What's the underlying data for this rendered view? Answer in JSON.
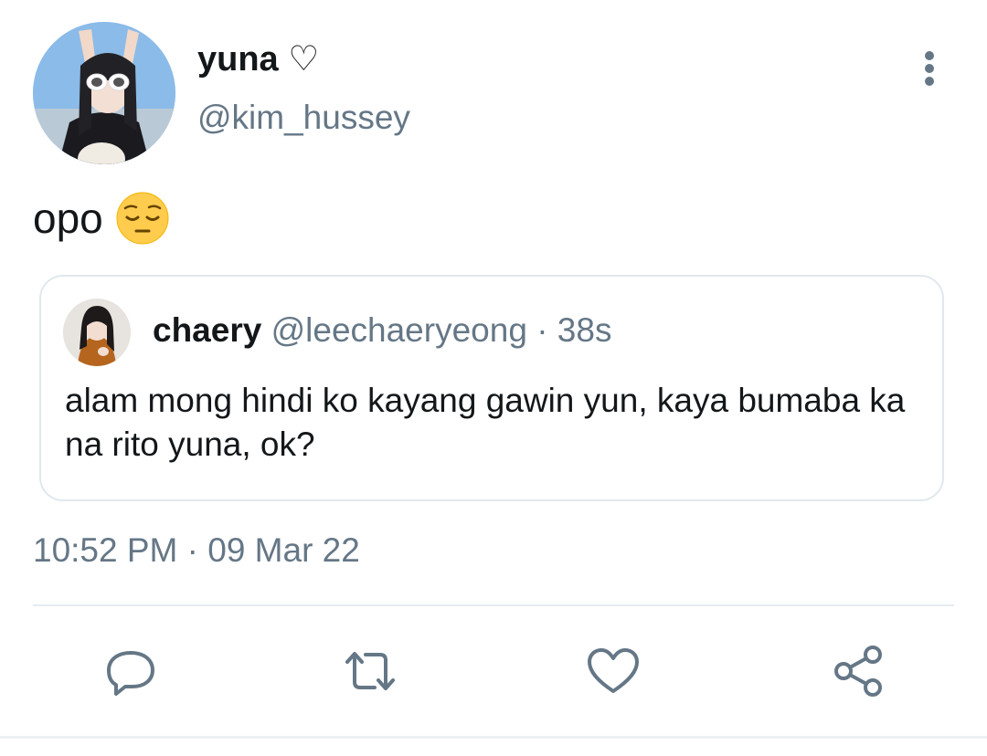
{
  "tweet": {
    "author": {
      "display_name": "yuna ♡",
      "handle": "@kim_hussey",
      "avatar_icon": "profile-photo"
    },
    "text": "opo",
    "emoji_icon": "pensive-face-emoji",
    "timestamp": "10:52 PM · 09 Mar 22"
  },
  "quoted_tweet": {
    "display_name": "chaery",
    "handle": "@leechaeryeong",
    "separator": "·",
    "time": "38s",
    "text": "alam mong hindi ko kayang gawin yun, kaya bumaba ka na rito yuna, ok?"
  },
  "actions": [
    {
      "icon": "reply-icon"
    },
    {
      "icon": "retweet-icon"
    },
    {
      "icon": "like-icon"
    },
    {
      "icon": "share-icon"
    }
  ],
  "colors": {
    "text_primary": "#14171a",
    "text_secondary": "#657786",
    "icon_gray": "#657786",
    "border": "#e1e8ed"
  }
}
